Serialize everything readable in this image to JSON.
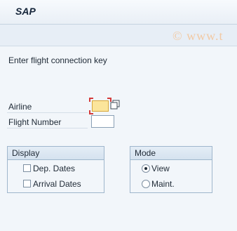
{
  "app": {
    "title": "SAP"
  },
  "watermark": {
    "text": "© www.t"
  },
  "screen": {
    "heading": "Enter flight connection key"
  },
  "fields": {
    "airline": {
      "label": "Airline",
      "value": "",
      "required": true
    },
    "flight_number": {
      "label": "Flight Number",
      "value": ""
    }
  },
  "display_group": {
    "title": "Display",
    "options": [
      {
        "label": "Dep. Dates",
        "checked": false
      },
      {
        "label": "Arrival Dates",
        "checked": false
      }
    ]
  },
  "mode_group": {
    "title": "Mode",
    "options": [
      {
        "label": "View",
        "selected": true
      },
      {
        "label": "Maint.",
        "selected": false
      }
    ]
  },
  "colors": {
    "required_fill": "#fbe59b",
    "required_marker": "#d43b3b"
  },
  "icons": {
    "value_help": "value-help-icon"
  }
}
